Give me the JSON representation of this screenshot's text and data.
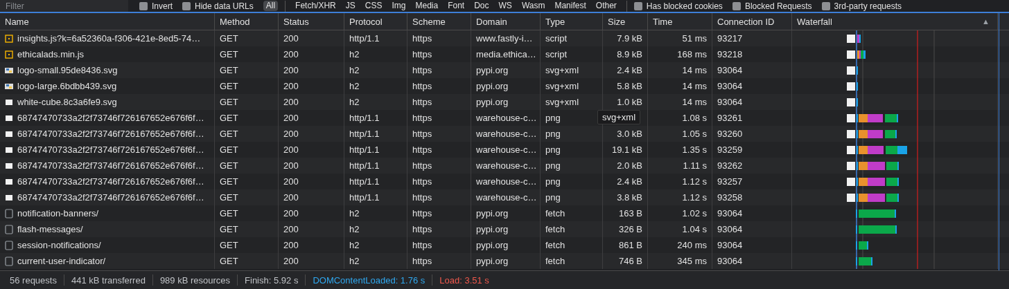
{
  "toolbar": {
    "filter": {
      "placeholder": "Filter"
    },
    "checks_left": [
      {
        "label": "Invert",
        "checked": false
      },
      {
        "label": "Hide data URLs",
        "checked": false
      }
    ],
    "type_filters": [
      {
        "label": "All",
        "selected": true
      },
      {
        "label": "Fetch/XHR",
        "selected": false
      },
      {
        "label": "JS",
        "selected": false
      },
      {
        "label": "CSS",
        "selected": false
      },
      {
        "label": "Img",
        "selected": false
      },
      {
        "label": "Media",
        "selected": false
      },
      {
        "label": "Font",
        "selected": false
      },
      {
        "label": "Doc",
        "selected": false
      },
      {
        "label": "WS",
        "selected": false
      },
      {
        "label": "Wasm",
        "selected": false
      },
      {
        "label": "Manifest",
        "selected": false
      },
      {
        "label": "Other",
        "selected": false
      }
    ],
    "checks_right": [
      {
        "label": "Has blocked cookies",
        "checked": false
      },
      {
        "label": "Blocked Requests",
        "checked": false
      },
      {
        "label": "3rd-party requests",
        "checked": false
      }
    ]
  },
  "table": {
    "columns": [
      "Name",
      "Method",
      "Status",
      "Protocol",
      "Scheme",
      "Domain",
      "Type",
      "Size",
      "Time",
      "Connection ID",
      "Waterfall"
    ],
    "sort_indicator": "▲",
    "rows": [
      {
        "kind": "script",
        "name": "insights.js?k=6a52360a-f306-421e-8ed5-74…",
        "method": "GET",
        "status": "200",
        "protocol": "http/1.1",
        "scheme": "https",
        "domain": "www.fastly-i…",
        "type": "script",
        "size": "7.9 kB",
        "time": "51 ms",
        "connection_id": "93217"
      },
      {
        "kind": "script",
        "name": "ethicalads.min.js",
        "method": "GET",
        "status": "200",
        "protocol": "h2",
        "scheme": "https",
        "domain": "media.ethica…",
        "type": "script",
        "size": "8.9 kB",
        "time": "168 ms",
        "connection_id": "93218"
      },
      {
        "kind": "logo",
        "name": "logo-small.95de8436.svg",
        "method": "GET",
        "status": "200",
        "protocol": "h2",
        "scheme": "https",
        "domain": "pypi.org",
        "type": "svg+xml",
        "size": "2.4 kB",
        "time": "14 ms",
        "connection_id": "93064"
      },
      {
        "kind": "logo",
        "name": "logo-large.6bdbb439.svg",
        "method": "GET",
        "status": "200",
        "protocol": "h2",
        "scheme": "https",
        "domain": "pypi.org",
        "type": "svg+xml",
        "size": "5.8 kB",
        "time": "14 ms",
        "connection_id": "93064"
      },
      {
        "kind": "image",
        "name": "white-cube.8c3a6fe9.svg",
        "method": "GET",
        "status": "200",
        "protocol": "h2",
        "scheme": "https",
        "domain": "pypi.org",
        "type": "svg+xml",
        "size": "1.0 kB",
        "time": "14 ms",
        "connection_id": "93064"
      },
      {
        "kind": "image",
        "name": "68747470733a2f2f73746f726167652e676f6f…",
        "method": "GET",
        "status": "200",
        "protocol": "http/1.1",
        "scheme": "https",
        "domain": "warehouse-c…",
        "type": "png",
        "tooltip": "svg+xml",
        "time": "1.08 s",
        "connection_id": "93261"
      },
      {
        "kind": "image",
        "name": "68747470733a2f2f73746f726167652e676f6f…",
        "method": "GET",
        "status": "200",
        "protocol": "http/1.1",
        "scheme": "https",
        "domain": "warehouse-c…",
        "type": "png",
        "size": "3.0 kB",
        "time": "1.05 s",
        "connection_id": "93260"
      },
      {
        "kind": "image",
        "name": "68747470733a2f2f73746f726167652e676f6f…",
        "method": "GET",
        "status": "200",
        "protocol": "http/1.1",
        "scheme": "https",
        "domain": "warehouse-c…",
        "type": "png",
        "size": "19.1 kB",
        "time": "1.35 s",
        "connection_id": "93259"
      },
      {
        "kind": "image",
        "name": "68747470733a2f2f73746f726167652e676f6f…",
        "method": "GET",
        "status": "200",
        "protocol": "http/1.1",
        "scheme": "https",
        "domain": "warehouse-c…",
        "type": "png",
        "size": "2.0 kB",
        "time": "1.11 s",
        "connection_id": "93262"
      },
      {
        "kind": "image",
        "name": "68747470733a2f2f73746f726167652e676f6f…",
        "method": "GET",
        "status": "200",
        "protocol": "http/1.1",
        "scheme": "https",
        "domain": "warehouse-c…",
        "type": "png",
        "size": "2.4 kB",
        "time": "1.12 s",
        "connection_id": "93257"
      },
      {
        "kind": "image",
        "name": "68747470733a2f2f73746f726167652e676f6f…",
        "method": "GET",
        "status": "200",
        "protocol": "http/1.1",
        "scheme": "https",
        "domain": "warehouse-c…",
        "type": "png",
        "size": "3.8 kB",
        "time": "1.12 s",
        "connection_id": "93258"
      },
      {
        "kind": "fetch",
        "name": "notification-banners/",
        "method": "GET",
        "status": "200",
        "protocol": "h2",
        "scheme": "https",
        "domain": "pypi.org",
        "type": "fetch",
        "size": "163 B",
        "time": "1.02 s",
        "connection_id": "93064"
      },
      {
        "kind": "fetch",
        "name": "flash-messages/",
        "method": "GET",
        "status": "200",
        "protocol": "h2",
        "scheme": "https",
        "domain": "pypi.org",
        "type": "fetch",
        "size": "326 B",
        "time": "1.04 s",
        "connection_id": "93064"
      },
      {
        "kind": "fetch",
        "name": "session-notifications/",
        "method": "GET",
        "status": "200",
        "protocol": "h2",
        "scheme": "https",
        "domain": "pypi.org",
        "type": "fetch",
        "size": "861 B",
        "time": "240 ms",
        "connection_id": "93064"
      },
      {
        "kind": "fetch",
        "name": "current-user-indicator/",
        "method": "GET",
        "status": "200",
        "protocol": "h2",
        "scheme": "https",
        "domain": "pypi.org",
        "type": "fetch",
        "size": "746 B",
        "time": "345 ms",
        "connection_id": "93064"
      }
    ]
  },
  "status_bar": [
    {
      "kind": "plain",
      "text": "56 requests"
    },
    {
      "kind": "plain",
      "text": "441 kB transferred"
    },
    {
      "kind": "plain",
      "text": "989 kB resources"
    },
    {
      "kind": "plain",
      "text": "Finish: 5.92 s"
    },
    {
      "kind": "dom",
      "text": "DOMContentLoaded: 1.76 s"
    },
    {
      "kind": "load",
      "text": "Load: 3.51 s"
    }
  ]
}
